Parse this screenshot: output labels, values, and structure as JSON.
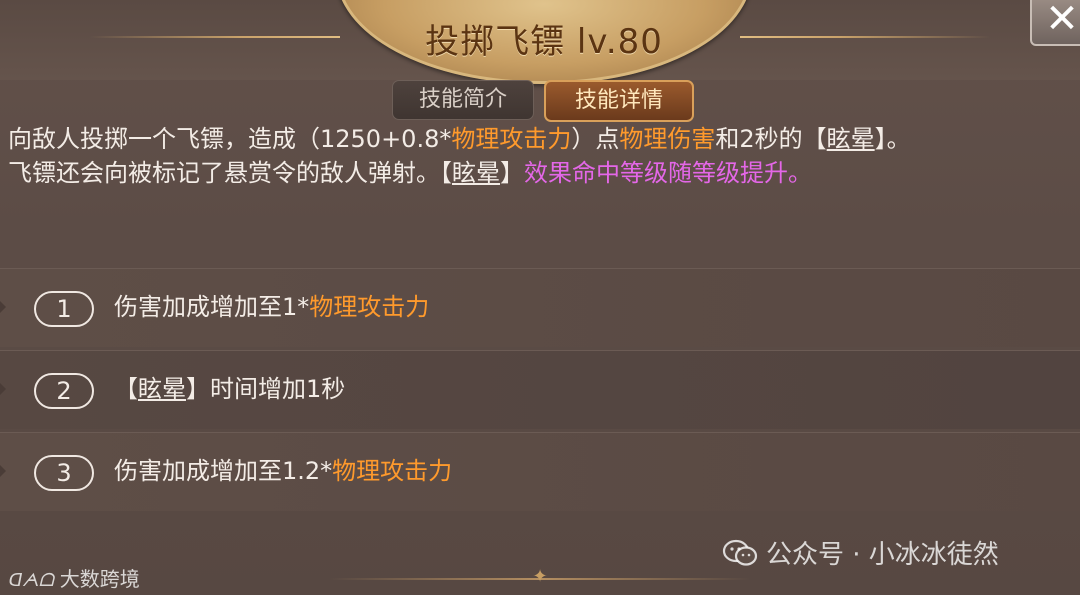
{
  "header": {
    "title": "投掷飞镖 lv.80",
    "close_icon": "close-icon"
  },
  "tabs": [
    {
      "label": "技能简介",
      "active": false
    },
    {
      "label": "技能详情",
      "active": true
    }
  ],
  "description": {
    "line1": {
      "t1": "向敌人投掷一个飞镖，造成（1250+0.8*",
      "t2": "物理攻击力",
      "t3": "）点",
      "t4": "物理伤害",
      "t5": "和2秒的【",
      "t6": "眩晕",
      "t7": "】。"
    },
    "line2": {
      "t1": "飞镖还会向被标记了悬赏令的敌人弹射。【",
      "t2": "眩晕",
      "t3": "】",
      "t4": "效果命中等级随等级提升。"
    }
  },
  "upgrades": [
    {
      "num": "1",
      "pre": "伤害加成增加至1*",
      "highlight": "物理攻击力",
      "tag_open": "",
      "tag": "",
      "tag_close": ""
    },
    {
      "num": "2",
      "pre": "",
      "highlight": "",
      "tag_open": "【",
      "tag": "眩晕",
      "tag_close": "】时间增加1秒"
    },
    {
      "num": "3",
      "pre": "伤害加成增加至1.2*",
      "highlight": "物理攻击力",
      "tag_open": "",
      "tag": "",
      "tag_close": ""
    }
  ],
  "watermarks": {
    "right": "公众号 · 小冰冰徒然",
    "left_logo": "ᗡᗅᗝ",
    "left": "大数跨境"
  },
  "colors": {
    "highlight_orange": "#ff9a2c",
    "highlight_purple": "#e467e8",
    "text": "#f3ece6"
  }
}
